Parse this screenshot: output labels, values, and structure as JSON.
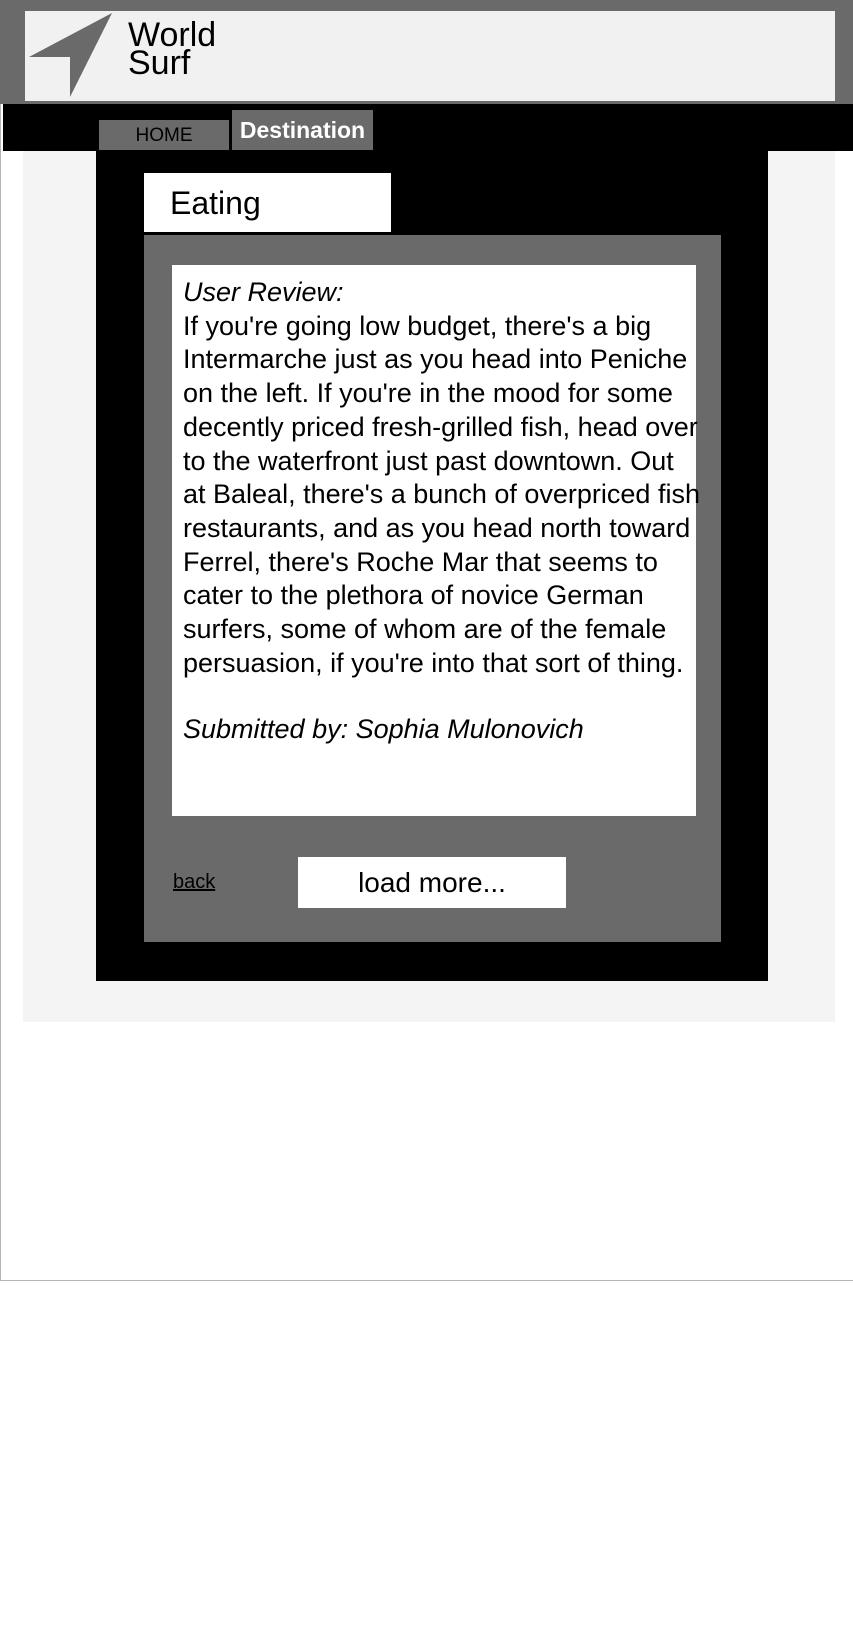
{
  "header": {
    "logo_icon": "arrow-pointer-icon",
    "title_line1": "World",
    "title_line2": "Surf"
  },
  "nav": {
    "home_label": "HOME",
    "destination_label": "Destination"
  },
  "section": {
    "tab_label": "Eating"
  },
  "review": {
    "heading": "User Review:",
    "body": "If you're going low budget, there's a big Intermarche just as you head into Peniche on the left. If you're in the mood for some decently priced fresh-grilled fish, head over to the waterfront just past downtown. Out at Baleal, there's a bunch of overpriced fish restaurants, and as you head north toward Ferrel, there's Roche Mar that seems to cater to the plethora of novice German surfers, some of whom are of the female persuasion, if you're into that sort of thing.",
    "author": "Submitted by: Sophia Mulonovich"
  },
  "actions": {
    "back_label": "back",
    "load_more_label": "load more..."
  },
  "colors": {
    "dark_grey": "#6a6a6a",
    "black": "#000000",
    "light_bg": "#f4f4f4",
    "header_inner": "#f1f1f1"
  }
}
